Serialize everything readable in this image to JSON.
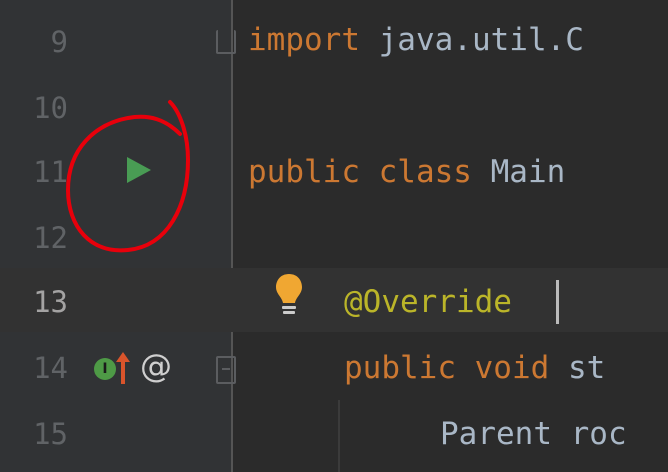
{
  "editor": {
    "line_numbers": [
      "9",
      "10",
      "11",
      "12",
      "13",
      "14",
      "15"
    ],
    "current_line": "13",
    "code": {
      "import_kw": "import",
      "import_rest": " java.util.C",
      "class_kw": "public class",
      "class_name": " Main",
      "annotation": "@Override",
      "method_kw": "public void",
      "method_rest": " st",
      "body_text": "Parent roc"
    },
    "gutter_icons": [
      "run-icon",
      "implements-icon",
      "override-arrow-icon",
      "at-icon"
    ],
    "at_symbol": "@",
    "implements_letter": "I"
  },
  "colors": {
    "keyword": "#cc7832",
    "annotation": "#bbb529",
    "text": "#a9b7c6",
    "run": "#499c54",
    "annotation_circle": "#e8000b",
    "bulb": "#f0a732"
  }
}
